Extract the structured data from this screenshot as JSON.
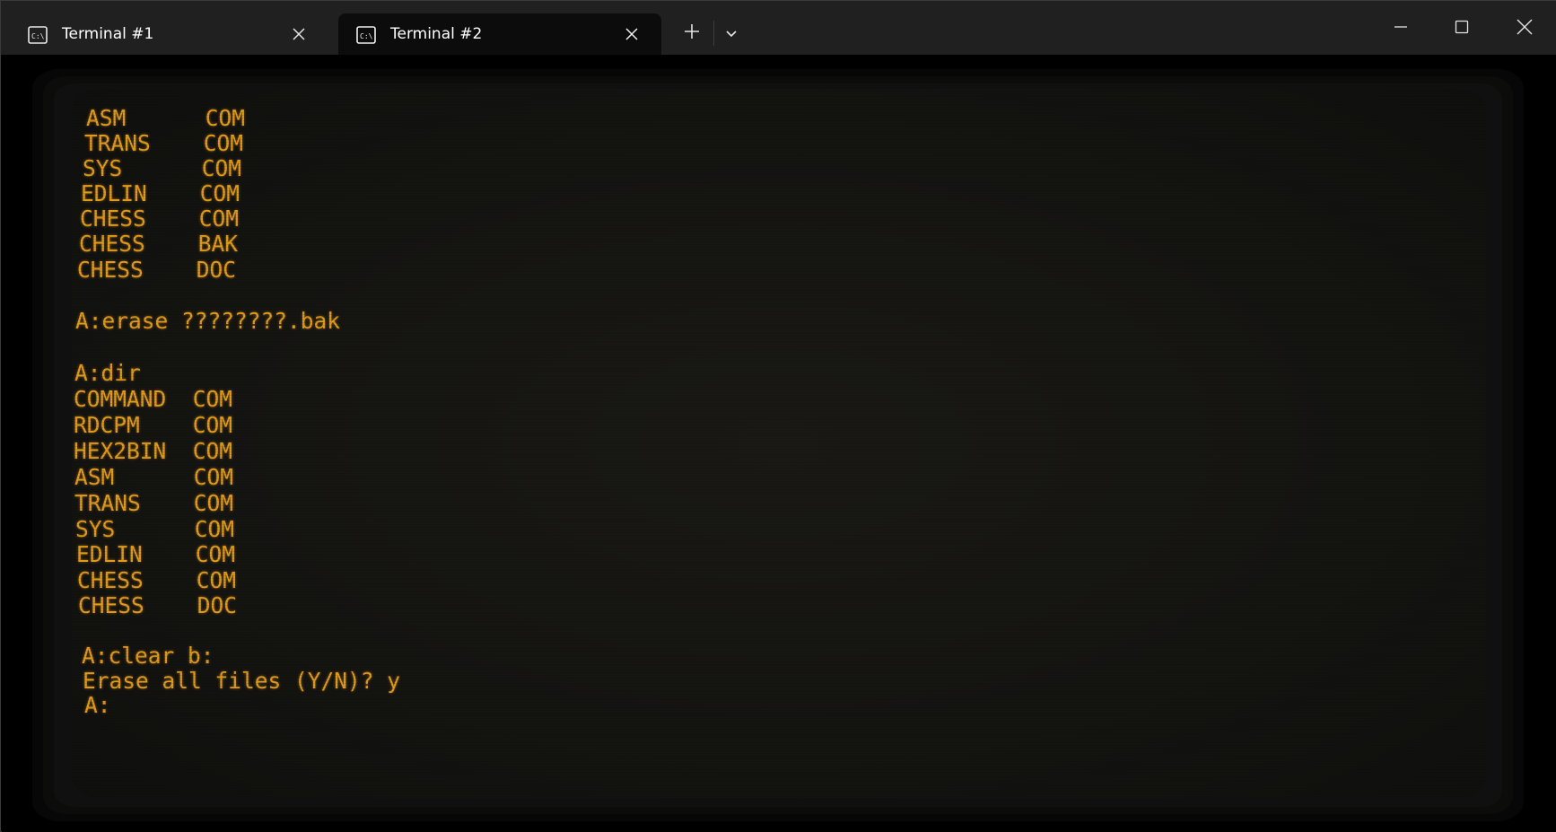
{
  "tabs": [
    {
      "label": "Terminal #1",
      "active": false
    },
    {
      "label": "Terminal #2",
      "active": true
    }
  ],
  "icons": {
    "tab_icon": "command-prompt-icon",
    "close": "close-icon",
    "new_tab": "plus-icon",
    "dropdown": "chevron-down-icon",
    "minimize": "minimize-icon",
    "maximize": "maximize-icon",
    "window_close": "window-close-icon"
  },
  "colors": {
    "titlebar": "#202020",
    "active_tab": "#0c0c0c",
    "terminal_text": "#e09a1e",
    "screen": "#141411"
  },
  "terminal": {
    "lines": [
      "ASM      COM",
      "TRANS    COM",
      "SYS      COM",
      "EDLIN    COM",
      "CHESS    COM",
      "CHESS    BAK",
      "CHESS    DOC",
      "A:erase ????????.bak",
      "A:dir",
      "COMMAND  COM",
      "RDCPM    COM",
      "HEX2BIN  COM",
      "ASM      COM",
      "TRANS    COM",
      "SYS      COM",
      "EDLIN    COM",
      "CHESS    COM",
      "CHESS    DOC",
      "A:clear b:",
      "Erase all files (Y/N)? y",
      "A:"
    ]
  }
}
